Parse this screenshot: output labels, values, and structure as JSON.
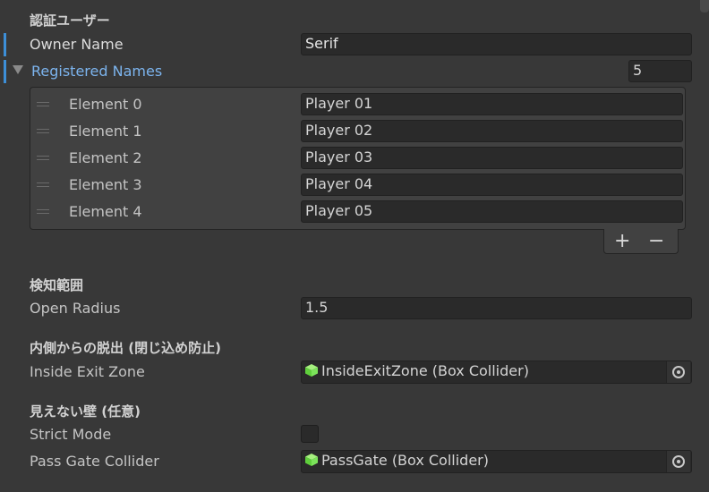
{
  "sections": {
    "auth_header": "認証ユーザー",
    "detect_header": "検知範囲",
    "exit_header": "内側からの脱出 (閉じ込め防止)",
    "wall_header": "見えない壁 (任意)"
  },
  "owner": {
    "label": "Owner Name",
    "value": "Serif"
  },
  "registered": {
    "label": "Registered Names",
    "count": "5",
    "elements": [
      {
        "label": "Element 0",
        "value": "Player 01"
      },
      {
        "label": "Element 1",
        "value": "Player 02"
      },
      {
        "label": "Element 2",
        "value": "Player 03"
      },
      {
        "label": "Element 3",
        "value": "Player 04"
      },
      {
        "label": "Element 4",
        "value": "Player 05"
      }
    ],
    "add_label": "+",
    "remove_label": "−"
  },
  "open_radius": {
    "label": "Open Radius",
    "value": "1.5"
  },
  "inside_exit": {
    "label": "Inside Exit Zone",
    "value": "InsideExitZone (Box Collider)",
    "icon": "collider-cube-icon"
  },
  "strict_mode": {
    "label": "Strict Mode",
    "checked": false
  },
  "pass_gate": {
    "label": "Pass Gate Collider",
    "value": "PassGate (Box Collider)",
    "icon": "collider-cube-icon"
  },
  "colors": {
    "background": "#383838",
    "field": "#2a2a2a",
    "accent_blue": "#7cb4ee",
    "modified_bar": "#3d8fd8",
    "cube_green": "#7be35a"
  }
}
